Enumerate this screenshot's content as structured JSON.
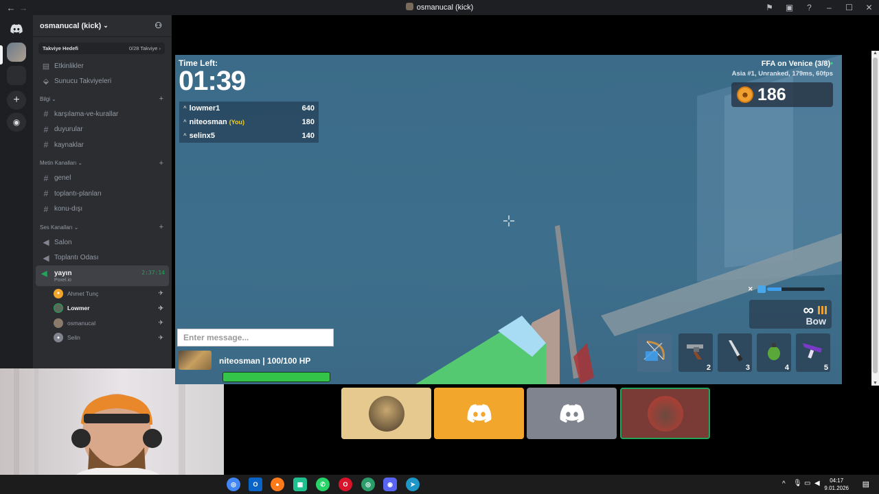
{
  "window": {
    "title": "osmanucal (kick)"
  },
  "server": {
    "name": "osmanucal (kick)",
    "boost": {
      "label": "Takviye Hedefi",
      "count": "0/28 Takviye"
    },
    "top_items": [
      {
        "label": "Etkinlikler",
        "icon": "calendar-icon"
      },
      {
        "label": "Sunucu Takviyeleri",
        "icon": "boost-gem-icon"
      }
    ],
    "categories": [
      {
        "name": "Bilgi",
        "channels": [
          "karşılama-ve-kurallar",
          "duyurular",
          "kaynaklar"
        ]
      },
      {
        "name": "Metin Kanalları",
        "channels": [
          "genel",
          "toplantı-planları",
          "konu-dışı"
        ]
      },
      {
        "name": "Ses Kanalları",
        "channels": [
          "Salon",
          "Toplantı Odası"
        ]
      }
    ],
    "active_voice": {
      "name": "yayın",
      "subtitle": "Poxel.io",
      "elapsed": "2:37:14",
      "members": [
        "Ahmet Tunç",
        "Lowmer",
        "osmanucal",
        "Selin"
      ]
    }
  },
  "game": {
    "time_left_label": "Time Left:",
    "time_left": "01:39",
    "leaderboard": [
      {
        "name": "lowmer1",
        "score": "640",
        "you": ""
      },
      {
        "name": "niteosman",
        "score": "180",
        "you": "(You)"
      },
      {
        "name": "selinx5",
        "score": "140",
        "you": ""
      }
    ],
    "mode": "FFA on Venice (3/8)",
    "server_info": "Asia #1, Unranked, 179ms, 60fps",
    "coins": "186",
    "chat_placeholder": "Enter message...",
    "player_hp": "niteosman | 100/100 HP",
    "hp_fraction": 1.0,
    "durability_fraction": 0.25,
    "weapon_name": "Bow",
    "ammo": "∞",
    "hotbar": [
      {
        "num": "",
        "item": "bow-icon"
      },
      {
        "num": "2",
        "item": "revolver-icon"
      },
      {
        "num": "3",
        "item": "knife-icon"
      },
      {
        "num": "4",
        "item": "grenade-icon"
      },
      {
        "num": "5",
        "item": "rifle-icon"
      }
    ]
  },
  "taskbar": {
    "time": "04:17",
    "date": "9.01.2026"
  },
  "colors": {
    "discord_blurple": "#5865f2",
    "accent_orange": "#f2a72c",
    "online_green": "#23a559"
  }
}
